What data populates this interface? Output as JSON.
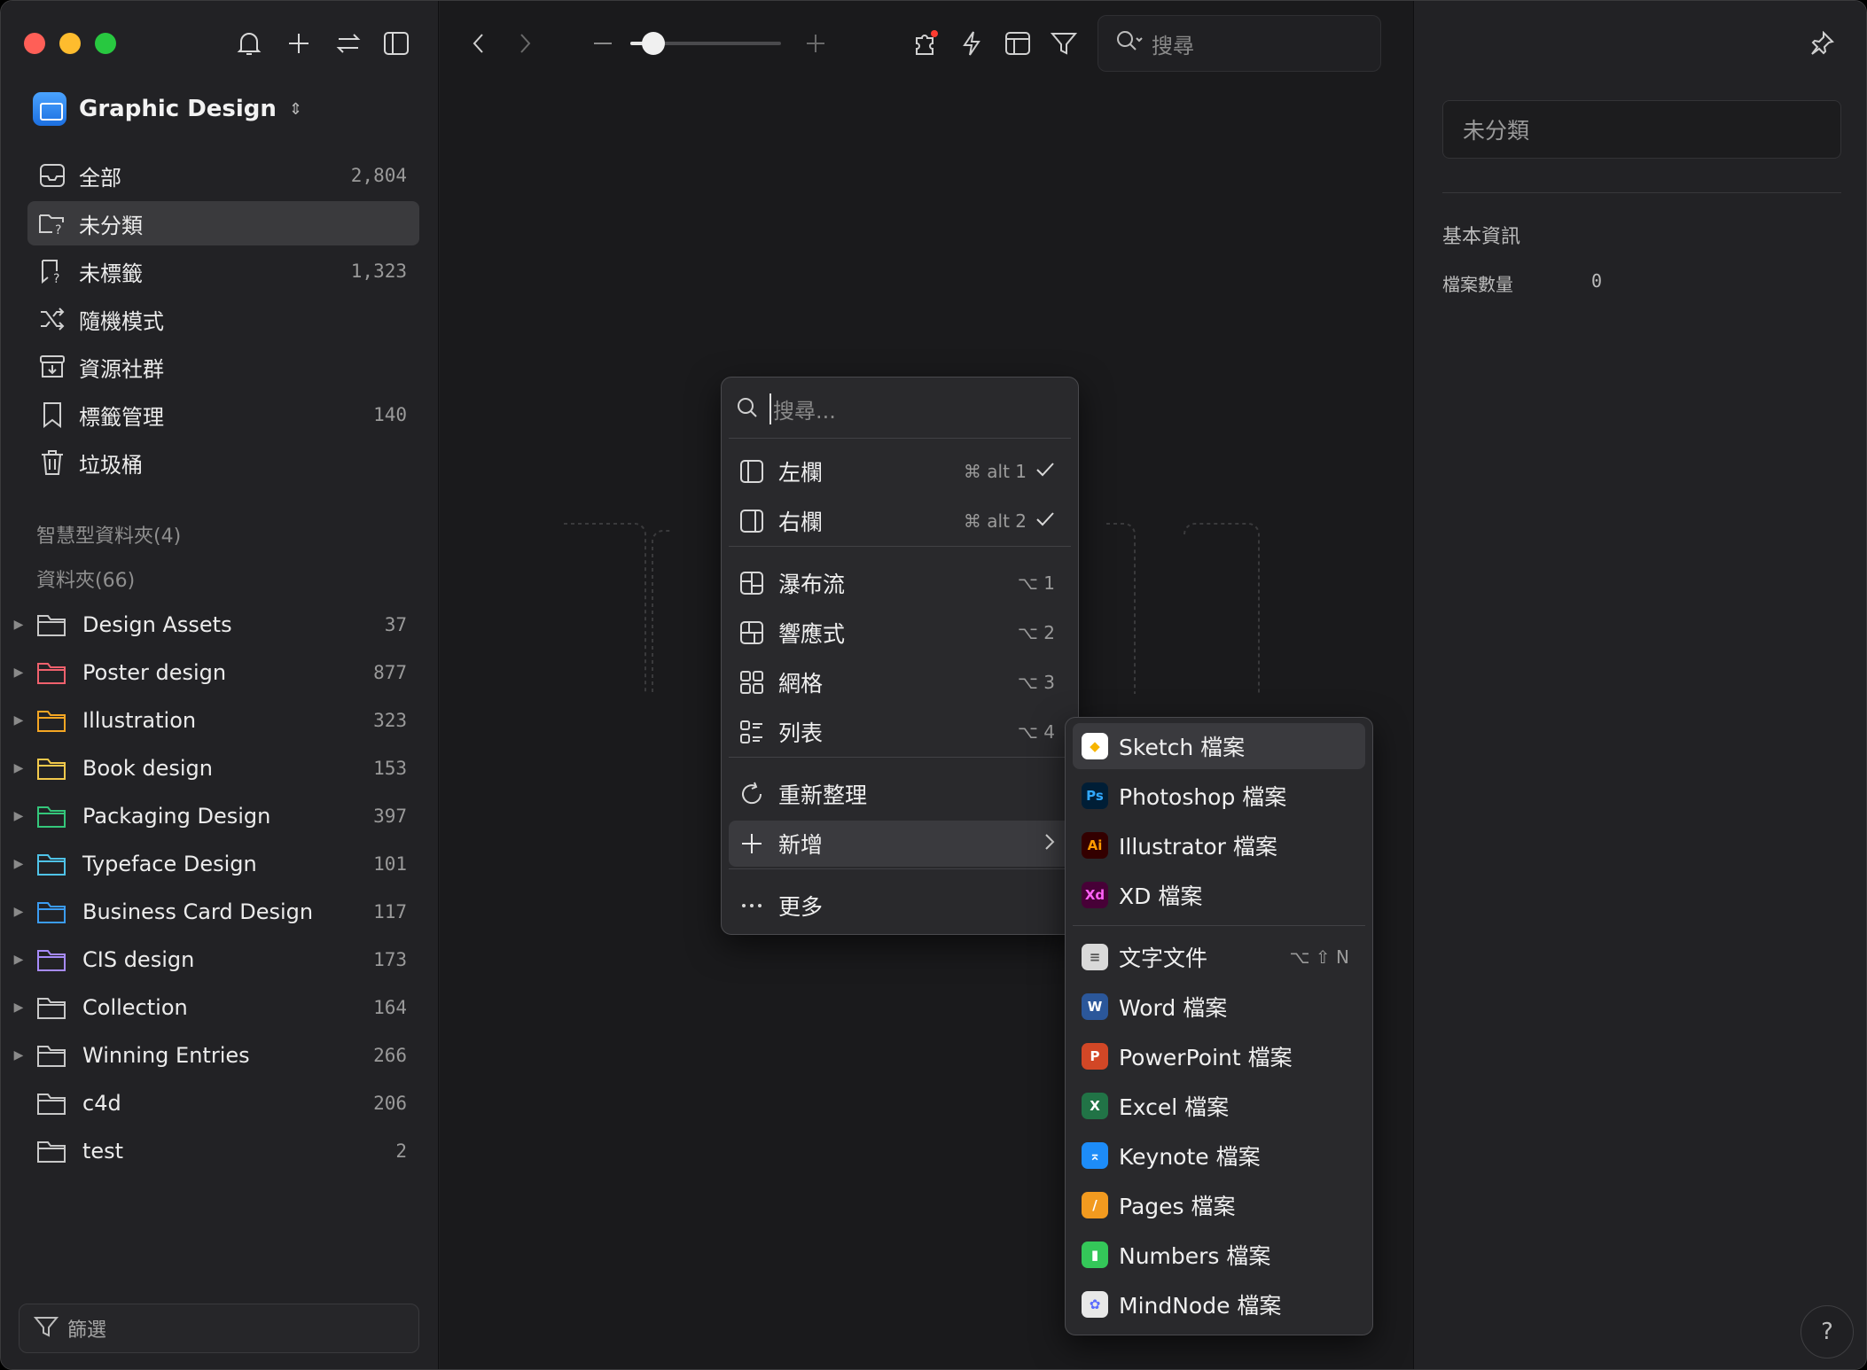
{
  "window": {
    "traffic_colors": {
      "close": "#ff5f57",
      "minimize": "#febc2e",
      "zoom": "#28c840"
    }
  },
  "sidebar": {
    "library_title": "Graphic Design",
    "library_chevron": "⌃",
    "nav": [
      {
        "label": "全部",
        "count": "2,804",
        "icon": "tray-icon"
      },
      {
        "label": "未分類",
        "count": "",
        "icon": "folder-question-icon"
      },
      {
        "label": "未標籤",
        "count": "1,323",
        "icon": "tag-question-icon"
      },
      {
        "label": "隨機模式",
        "count": "",
        "icon": "shuffle-icon"
      },
      {
        "label": "資源社群",
        "count": "",
        "icon": "archive-download-icon"
      },
      {
        "label": "標籤管理",
        "count": "140",
        "icon": "bookmark-icon"
      },
      {
        "label": "垃圾桶",
        "count": "",
        "icon": "trash-icon"
      }
    ],
    "smart_folders_header": "智慧型資料夾(4)",
    "folders_header": "資料夾(66)",
    "folders": [
      {
        "label": "Design Assets",
        "count": "37",
        "color": "#c9c9c9",
        "expandable": true
      },
      {
        "label": "Poster design",
        "count": "877",
        "color": "#f0616d",
        "expandable": true
      },
      {
        "label": "Illustration",
        "count": "323",
        "color": "#f5a623",
        "expandable": true
      },
      {
        "label": "Book design",
        "count": "153",
        "color": "#f2c94c",
        "expandable": true
      },
      {
        "label": "Packaging Design",
        "count": "397",
        "color": "#34c77b",
        "expandable": true
      },
      {
        "label": "Typeface Design",
        "count": "101",
        "color": "#4fc3e8",
        "expandable": true
      },
      {
        "label": "Business Card Design",
        "count": "117",
        "color": "#3b9cf2",
        "expandable": true
      },
      {
        "label": "CIS design",
        "count": "173",
        "color": "#a78bfa",
        "expandable": true
      },
      {
        "label": "Collection",
        "count": "164",
        "color": "#c9c9c9",
        "expandable": true
      },
      {
        "label": "Winning Entries",
        "count": "266",
        "color": "#c9c9c9",
        "expandable": true
      },
      {
        "label": "c4d",
        "count": "206",
        "color": "#c9c9c9",
        "expandable": false
      },
      {
        "label": "test",
        "count": "2",
        "color": "#c9c9c9",
        "expandable": false
      }
    ],
    "filter_label": "篩選"
  },
  "toolbar": {
    "search_placeholder": "搜尋",
    "zoom_level": 0.15
  },
  "right_panel": {
    "name_value": "未分類",
    "section_title": "基本資訊",
    "file_count_label": "檔案數量",
    "file_count_value": "0"
  },
  "context_menu": {
    "search_placeholder": "搜尋...",
    "items": [
      {
        "label": "左欄",
        "shortcut": "⌘ alt 1",
        "checked": true,
        "icon": "left-panel-icon"
      },
      {
        "label": "右欄",
        "shortcut": "⌘ alt 2",
        "checked": true,
        "icon": "right-panel-icon"
      },
      {
        "label": "瀑布流",
        "shortcut": "⌥ 1",
        "icon": "waterfall-layout-icon"
      },
      {
        "label": "響應式",
        "shortcut": "⌥ 2",
        "icon": "responsive-layout-icon"
      },
      {
        "label": "網格",
        "shortcut": "⌥ 3",
        "icon": "grid-layout-icon"
      },
      {
        "label": "列表",
        "shortcut": "⌥ 4",
        "icon": "list-layout-icon"
      },
      {
        "label": "重新整理",
        "shortcut": "",
        "icon": "refresh-icon"
      },
      {
        "label": "新增",
        "shortcut": "",
        "icon": "plus-icon"
      },
      {
        "label": "更多",
        "shortcut": "",
        "icon": "more-icon"
      }
    ]
  },
  "submenu": {
    "items": [
      {
        "label": "Sketch 檔案",
        "badge": "◆",
        "bg": "#ffffff",
        "fg": "#f7b500"
      },
      {
        "label": "Photoshop 檔案",
        "badge": "Ps",
        "bg": "#001e36",
        "fg": "#31a8ff"
      },
      {
        "label": "Illustrator 檔案",
        "badge": "Ai",
        "bg": "#330000",
        "fg": "#ff9a00"
      },
      {
        "label": "XD 檔案",
        "badge": "Xd",
        "bg": "#470137",
        "fg": "#ff61f6"
      },
      {
        "label": "文字文件",
        "badge": "≡",
        "bg": "#d9d9d9",
        "fg": "#555555",
        "shortcut": "⌥ ⇧ N"
      },
      {
        "label": "Word 檔案",
        "badge": "W",
        "bg": "#2b579a",
        "fg": "#ffffff"
      },
      {
        "label": "PowerPoint 檔案",
        "badge": "P",
        "bg": "#d24726",
        "fg": "#ffffff"
      },
      {
        "label": "Excel 檔案",
        "badge": "X",
        "bg": "#217346",
        "fg": "#ffffff"
      },
      {
        "label": "Keynote 檔案",
        "badge": "⌅",
        "bg": "#1d8cf8",
        "fg": "#ffffff"
      },
      {
        "label": "Pages 檔案",
        "badge": "/",
        "bg": "#f29a1f",
        "fg": "#ffffff"
      },
      {
        "label": "Numbers 檔案",
        "badge": "▮",
        "bg": "#34c759",
        "fg": "#ffffff"
      },
      {
        "label": "MindNode 檔案",
        "badge": "✿",
        "bg": "#e8e8e8",
        "fg": "#5b6cff"
      }
    ]
  },
  "help_label": "?"
}
